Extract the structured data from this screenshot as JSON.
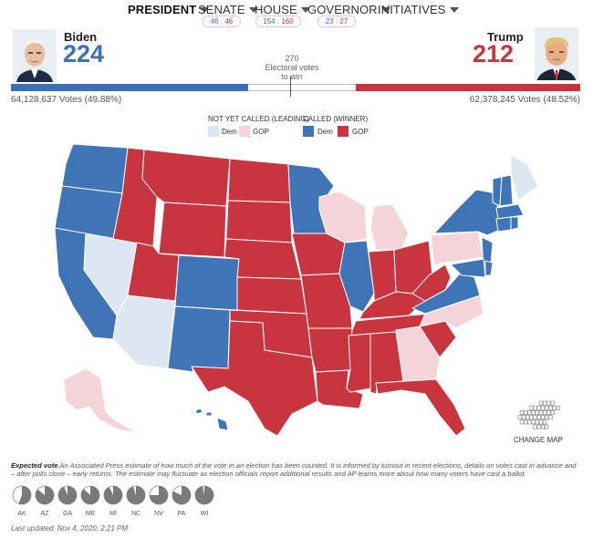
{
  "nav": {
    "president": "PRESIDENT",
    "senate": "SENATE",
    "senate_dem": "46",
    "senate_gop": "46",
    "house": "HOUSE",
    "house_dem": "154",
    "house_gop": "160",
    "governor": "GOVERNOR",
    "gov_dem": "23",
    "gov_gop": "27",
    "initiatives": "INITIATIVES",
    "chip_sep": ":"
  },
  "candidates": {
    "dem": {
      "name": "Biden",
      "electoral_votes": "224",
      "votes": "64,128,637 Votes (49.88%)",
      "color": "#3b6fb6"
    },
    "gop": {
      "name": "Trump",
      "electoral_votes": "212",
      "votes": "62,378,245 Votes (48.52%)",
      "color": "#c8353f"
    },
    "to_win_number": "270",
    "to_win_text_1": "Electoral votes",
    "to_win_text_2": "to win",
    "dem_ev_share": 0.4164,
    "gop_ev_share": 0.3941
  },
  "legend": {
    "leading_title": "NOT YET CALLED (LEADING)",
    "called_title": "CALLED (WINNER)",
    "dem": "Dem",
    "gop": "GOP",
    "colors": {
      "dem_called": "#3f74b6",
      "gop_called": "#c8353f",
      "dem_leading": "#dde7f1",
      "gop_leading": "#f4d3d9"
    }
  },
  "map": {
    "change_map": "CHANGE MAP"
  },
  "expected_vote": {
    "label": "Expected vote",
    "text": "An Associated Press estimate of how much of the vote in an election has been counted. It is informed by turnout in recent elections, details on votes cast in advance and – after polls close – early returns. The estimate may fluctuate as election officials report additional results and AP learns more about how many voters have cast a ballot.",
    "states": [
      {
        "code": "AK",
        "pct": 0.56
      },
      {
        "code": "AZ",
        "pct": 0.86
      },
      {
        "code": "GA",
        "pct": 0.94
      },
      {
        "code": "ME",
        "pct": 0.87
      },
      {
        "code": "MI",
        "pct": 0.93
      },
      {
        "code": "NC",
        "pct": 0.95
      },
      {
        "code": "NV",
        "pct": 0.75
      },
      {
        "code": "PA",
        "pct": 0.82
      },
      {
        "code": "WI",
        "pct": 0.97
      }
    ]
  },
  "last_updated": "Last updated: Nov 4, 2020, 2:21 PM"
}
